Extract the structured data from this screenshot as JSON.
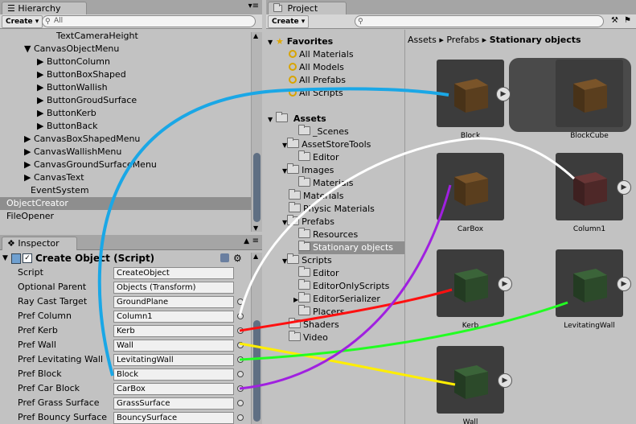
{
  "hierarchy": {
    "tab": "Hierarchy",
    "create": "Create",
    "search_placeholder": "All",
    "rows": [
      "TextCameraHeight",
      "▼ CanvasObjectMenu",
      "▶ ButtonColumn",
      "▶ ButtonBoxShaped",
      "▶ ButtonWallish",
      "▶ ButtonGroudSurface",
      "▶ ButtonKerb",
      "▶ ButtonBack",
      "▶ CanvasBoxShapedMenu",
      "▶ CanvasWallishMenu",
      "▶ CanvasGroundSurfaceMenu",
      "▶ CanvasText",
      "EventSystem",
      "ObjectCreator",
      "FileOpener"
    ]
  },
  "inspector": {
    "tab": "Inspector",
    "component_title": "Create Object (Script)",
    "fields": [
      {
        "label": "Script",
        "value": "CreateObject"
      },
      {
        "label": "Optional Parent",
        "value": "Objects (Transform)"
      },
      {
        "label": "Ray Cast Target",
        "value": "GroundPlane"
      },
      {
        "label": "Pref Column",
        "value": "Column1"
      },
      {
        "label": "Pref Kerb",
        "value": "Kerb"
      },
      {
        "label": "Pref Wall",
        "value": "Wall"
      },
      {
        "label": "Pref Levitating Wall",
        "value": "LevitatingWall"
      },
      {
        "label": "Pref Block",
        "value": "Block"
      },
      {
        "label": "Pref Car Block",
        "value": "CarBox"
      },
      {
        "label": "Pref Grass Surface",
        "value": "GrassSurface"
      },
      {
        "label": "Pref Bouncy Surface",
        "value": "BouncySurface"
      }
    ]
  },
  "project": {
    "tab": "Project",
    "create": "Create",
    "breadcrumb": {
      "a": "Assets",
      "b": "Prefabs",
      "c": "Stationary objects",
      "sep": "▸"
    },
    "favorites_label": "Favorites",
    "favorites": [
      "All Materials",
      "All Models",
      "All Prefabs",
      "All Scripts"
    ],
    "assets_label": "Assets",
    "tree": [
      "_Scenes",
      "AssetStoreTools",
      "Editor",
      "Images",
      "Materials",
      "Materials",
      "Physic Materials",
      "Prefabs",
      "Resources",
      "Stationary objects",
      "Scripts",
      "Editor",
      "EditorOnlyScripts",
      "EditorSerializer",
      "Placers",
      "Shaders",
      "Video"
    ],
    "tiles": [
      "Block",
      "BlockCube",
      "CarBox",
      "Column1",
      "Kerb",
      "LevitatingWall",
      "Wall"
    ]
  },
  "colors": {
    "selection": "#8e8e8e",
    "wire_blue": "#1aa7e6",
    "wire_white": "#ffffff",
    "wire_red": "#ff1010",
    "wire_yellow": "#ffee00",
    "wire_green": "#22ff22",
    "wire_purple": "#a020e0",
    "cube_brown": "#5a3e1e",
    "cube_red": "#4e2828",
    "cube_green": "#2c4a2a"
  }
}
